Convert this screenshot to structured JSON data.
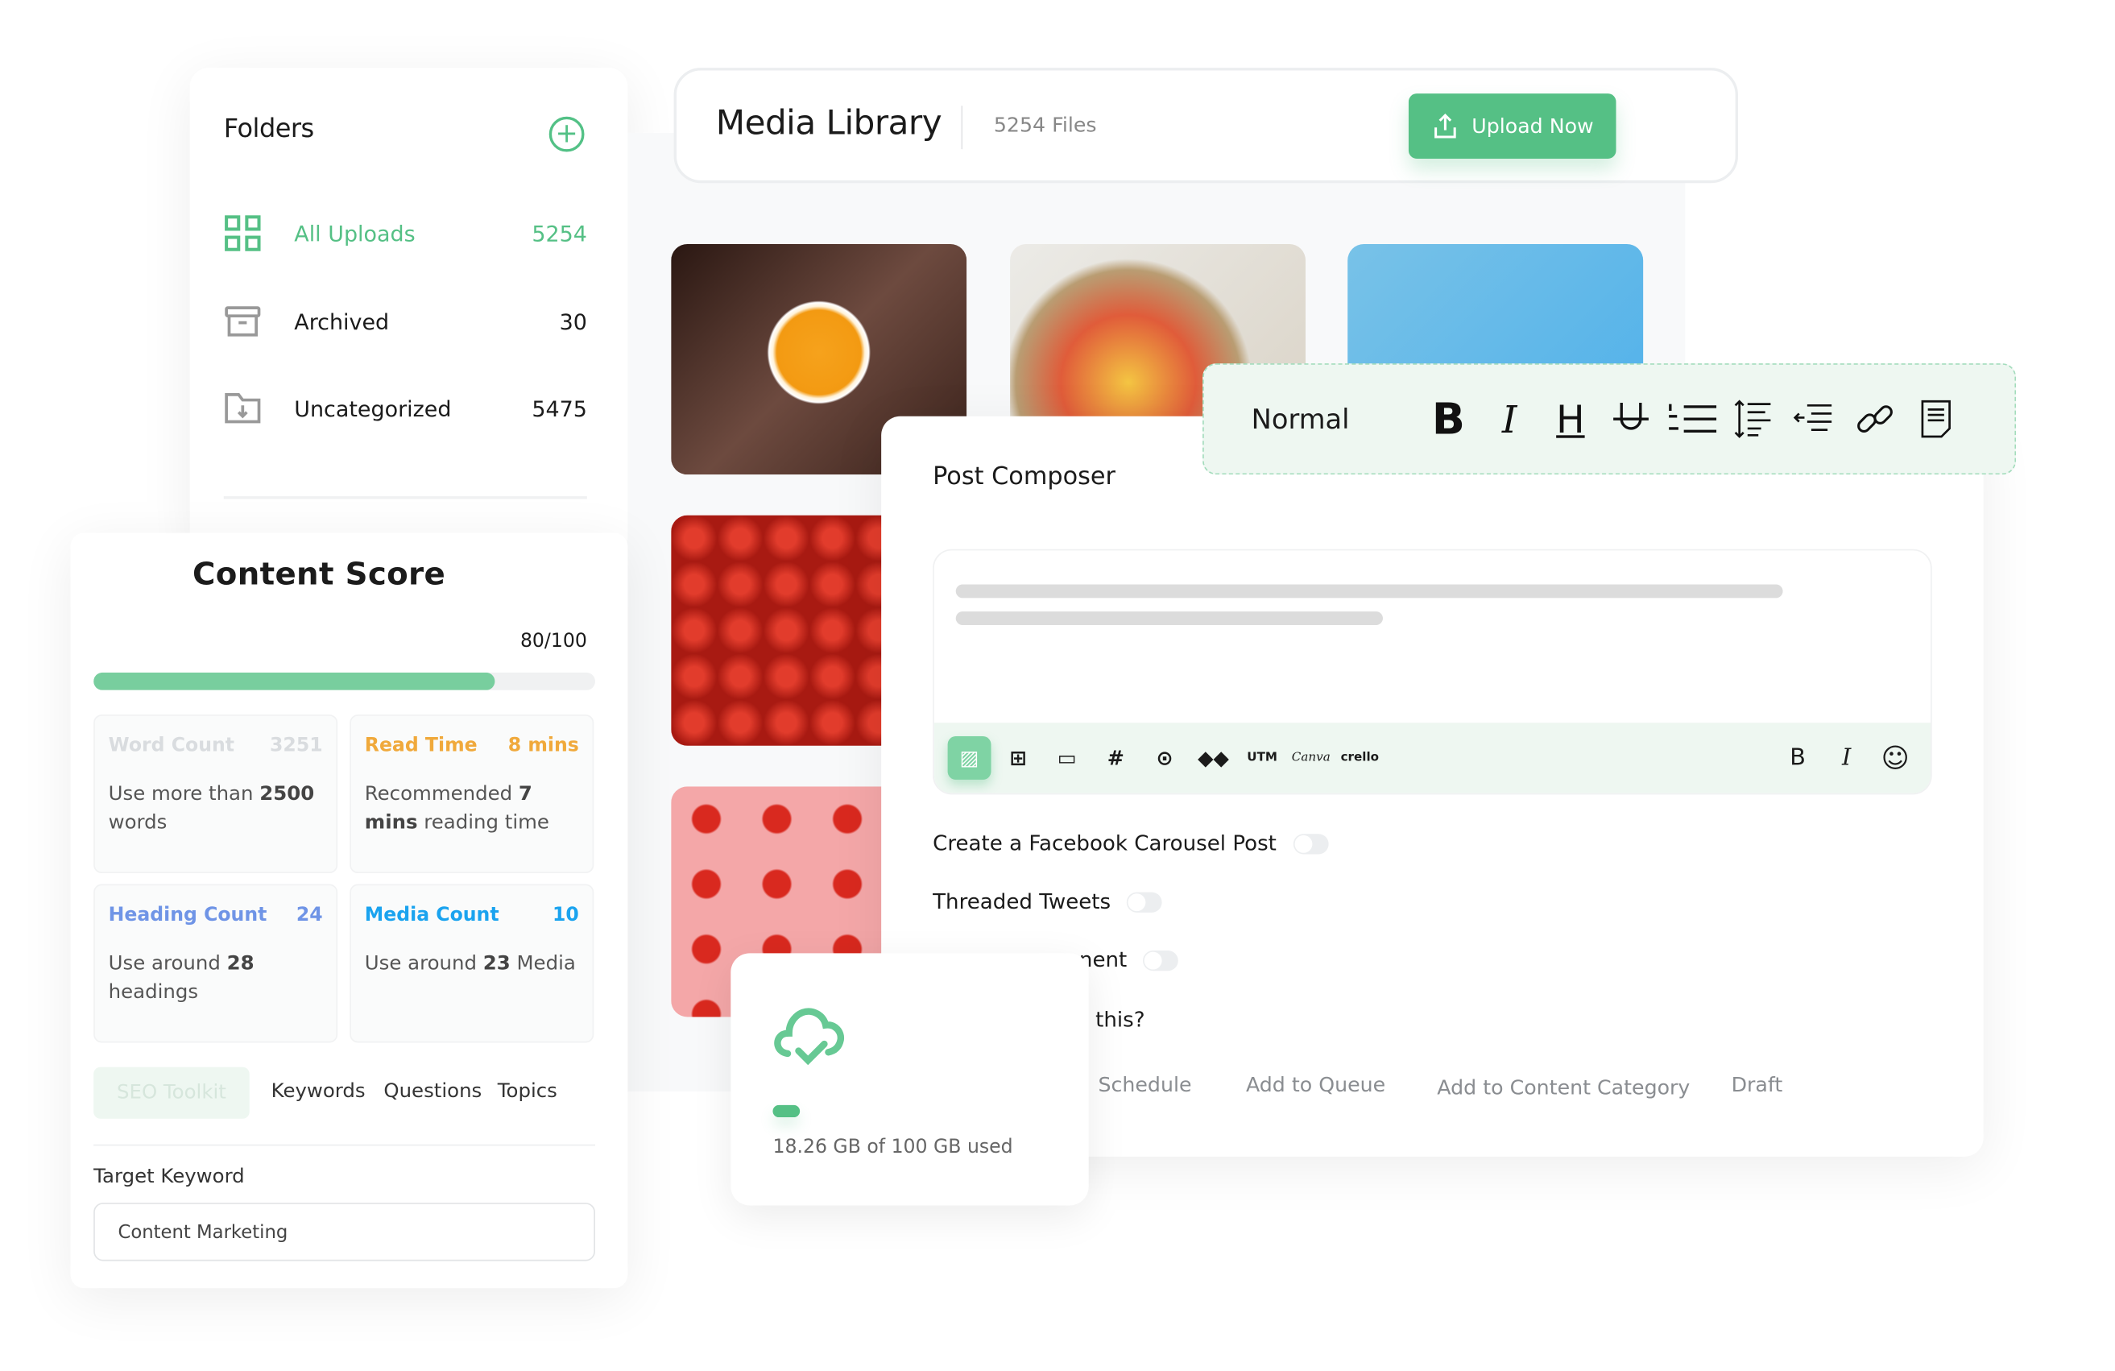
{
  "folders": {
    "title": "Folders",
    "add_icon": "plus-circle-icon",
    "items": [
      {
        "label": "All Uploads",
        "count": "5254",
        "icon": "grid-icon",
        "active": true
      },
      {
        "label": "Archived",
        "count": "30",
        "icon": "archive-box-icon"
      },
      {
        "label": "Uncategorized",
        "count": "5475",
        "icon": "folder-download-icon"
      }
    ]
  },
  "media_library": {
    "title": "Media Library",
    "file_count": "5254 Files",
    "upload_label": "Upload Now",
    "upload_icon": "upload-icon"
  },
  "format_toolbar": {
    "style": "Normal",
    "bold": "B",
    "italic": "I",
    "heading": "H",
    "icons": [
      "bold-icon",
      "italic-icon",
      "heading-icon",
      "underline-icon",
      "ordered-list-icon",
      "line-height-icon",
      "outdent-icon",
      "link-icon",
      "document-icon"
    ]
  },
  "composer": {
    "title": "Post Composer",
    "toolbar": {
      "utm": "UTM",
      "canva": "Canva",
      "crello": "crello",
      "bold": "B",
      "italic": "I"
    },
    "toggles": [
      {
        "label": "Create a Facebook Carousel Post",
        "on": false
      },
      {
        "label": "Threaded Tweets",
        "on": false
      },
      {
        "label": "nent",
        "on": false
      },
      {
        "label": "this?"
      }
    ],
    "actions": [
      "Schedule",
      "Add to Queue",
      "Add to Content Category",
      "Draft"
    ]
  },
  "storage": {
    "used_text": "18.26 GB of 100 GB used",
    "used_fraction": 0.1826,
    "icon": "cloud-check-icon"
  },
  "content_score": {
    "title": "Content Score",
    "score_text": "80/100",
    "score_fraction": 0.8,
    "metrics": [
      {
        "title": "Word Count",
        "value": "3251",
        "pre": "Use more than ",
        "bold": "2500",
        "post": " words",
        "color": "#d9dcdf"
      },
      {
        "title": "Read Time",
        "value": "8 mins",
        "pre": "Recommended ",
        "bold": "7 mins",
        "post": " reading time",
        "color": "#f0a93b"
      },
      {
        "title": "Heading Count",
        "value": "24",
        "pre": "Use around ",
        "bold": "28",
        "post": " headings",
        "color": "#6f94e6"
      },
      {
        "title": "Media Count",
        "value": "10",
        "pre": "Use around ",
        "bold": "23",
        "post": " Media",
        "color": "#1aa3ef"
      }
    ],
    "tabs": [
      "SEO Toolkit",
      "Keywords",
      "Questions",
      "Topics"
    ],
    "target_keyword_label": "Target Keyword",
    "target_keyword_value": "Content Marketing"
  },
  "colors": {
    "accent": "#55c085",
    "accent_light": "#eef7f1"
  }
}
